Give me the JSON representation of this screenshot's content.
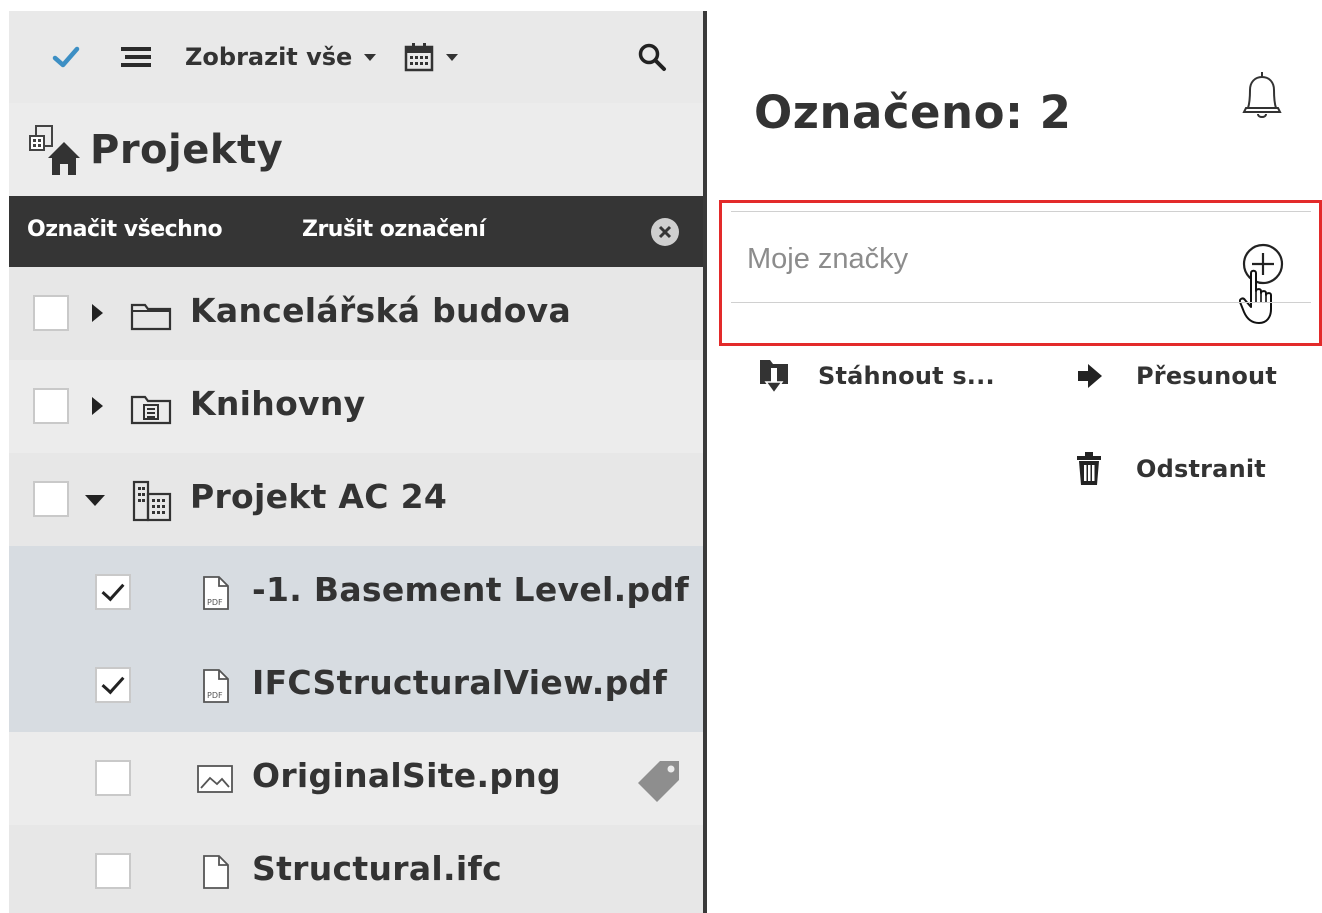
{
  "toolbar": {
    "check_icon": "check-icon",
    "list_icon": "list-icon",
    "show_all_label": "Zobrazit vše",
    "calendar_icon": "calendar-icon",
    "search_icon": "search-icon"
  },
  "projects": {
    "title": "Projekty",
    "icon": "projects-icon"
  },
  "selection_bar": {
    "select_all": "Označit všechno",
    "deselect": "Zrušit označení"
  },
  "tree": [
    {
      "label": "Kancelářská budova",
      "checked": false,
      "expanded": false,
      "icon": "folder-icon"
    },
    {
      "label": "Knihovny",
      "checked": false,
      "expanded": false,
      "icon": "library-folder-icon"
    },
    {
      "label": "Projekt AC 24",
      "checked": false,
      "expanded": true,
      "icon": "building-icon"
    },
    {
      "label": "-1. Basement Level.pdf",
      "checked": true,
      "icon": "pdf-file-icon"
    },
    {
      "label": "IFCStructuralView.pdf",
      "checked": true,
      "icon": "pdf-file-icon"
    },
    {
      "label": "OriginalSite.png",
      "checked": false,
      "icon": "image-file-icon",
      "tagged": true
    },
    {
      "label": "Structural.ifc",
      "checked": false,
      "icon": "file-icon"
    }
  ],
  "details": {
    "title": "Označeno: 2",
    "tags_placeholder": "Moje značky",
    "actions": {
      "download": "Stáhnout s...",
      "move": "Přesunout",
      "delete": "Odstranit"
    }
  },
  "colors": {
    "highlight_border": "#e32a2a",
    "selected_row": "#d7dce1",
    "selection_bar": "#353535",
    "accent_check": "#3d8fc4"
  }
}
